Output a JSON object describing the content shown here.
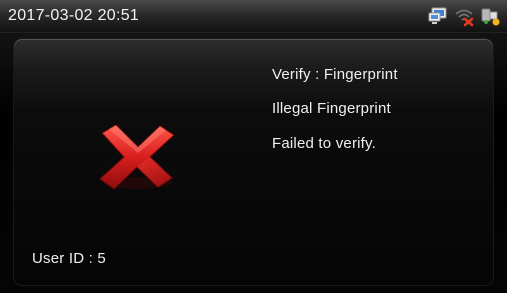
{
  "status_bar": {
    "datetime": "2017-03-02 20:51",
    "icons": [
      "network-icon",
      "wifi-disconnected-icon",
      "usb-icon"
    ]
  },
  "verify_panel": {
    "result_icon": "x-mark-icon",
    "verify_line": "Verify : Fingerprint",
    "error_line": "Illegal Fingerprint",
    "failed_line": "Failed to verify.",
    "user_id": "User ID : 5"
  },
  "colors": {
    "fail_red": "#d42020",
    "text": "#f0f0f0",
    "background": "#000000"
  }
}
